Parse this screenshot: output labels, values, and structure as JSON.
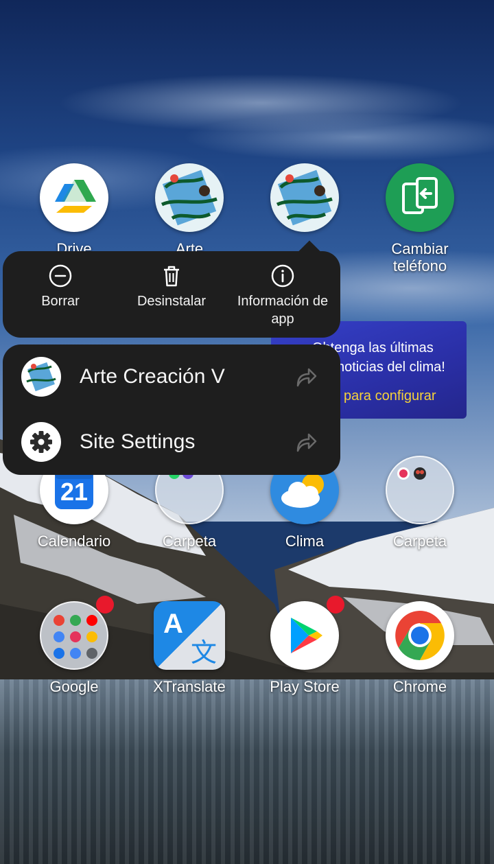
{
  "home": {
    "row1": [
      {
        "name": "Drive",
        "icon": "google-drive-icon"
      },
      {
        "name": "Arte",
        "icon": "arte-creacion-icon"
      },
      {
        "name": "",
        "icon": "arte-creacion-icon"
      },
      {
        "name": "Cambiar teléfono",
        "icon": "switch-phone-icon"
      }
    ],
    "row3": [
      {
        "name": "Calendario",
        "icon": "calendar-icon",
        "day": "21"
      },
      {
        "name": "Carpeta",
        "icon": "folder-icon"
      },
      {
        "name": "Clima",
        "icon": "weather-icon"
      },
      {
        "name": "Carpeta",
        "icon": "folder-icon"
      }
    ],
    "row4": [
      {
        "name": "Google",
        "icon": "google-folder-icon",
        "badge": true
      },
      {
        "name": "XTranslate",
        "icon": "xtranslate-icon"
      },
      {
        "name": "Play Store",
        "icon": "play-store-icon",
        "badge": true
      },
      {
        "name": "Chrome",
        "icon": "chrome-icon"
      }
    ]
  },
  "context_menu": {
    "actions": [
      {
        "label": "Borrar",
        "icon": "minus-circle-icon"
      },
      {
        "label": "Desinstalar",
        "icon": "trash-icon"
      },
      {
        "label": "Información de app",
        "icon": "info-icon"
      }
    ],
    "shortcuts": [
      {
        "label": "Arte Creación V",
        "icon": "arte-creacion-icon",
        "pin_icon": "pin-shortcut-icon"
      },
      {
        "label": "Site Settings",
        "icon": "gear-icon",
        "pin_icon": "pin-shortcut-icon"
      }
    ]
  },
  "weather_widget": {
    "line1": "Obtenga las últimas",
    "line2": "noticias del clima!",
    "cta": "para configurar",
    "cta_color": "#f6d23a"
  },
  "colors": {
    "menu_bg": "#1e1e1e",
    "badge": "#e8192c"
  }
}
